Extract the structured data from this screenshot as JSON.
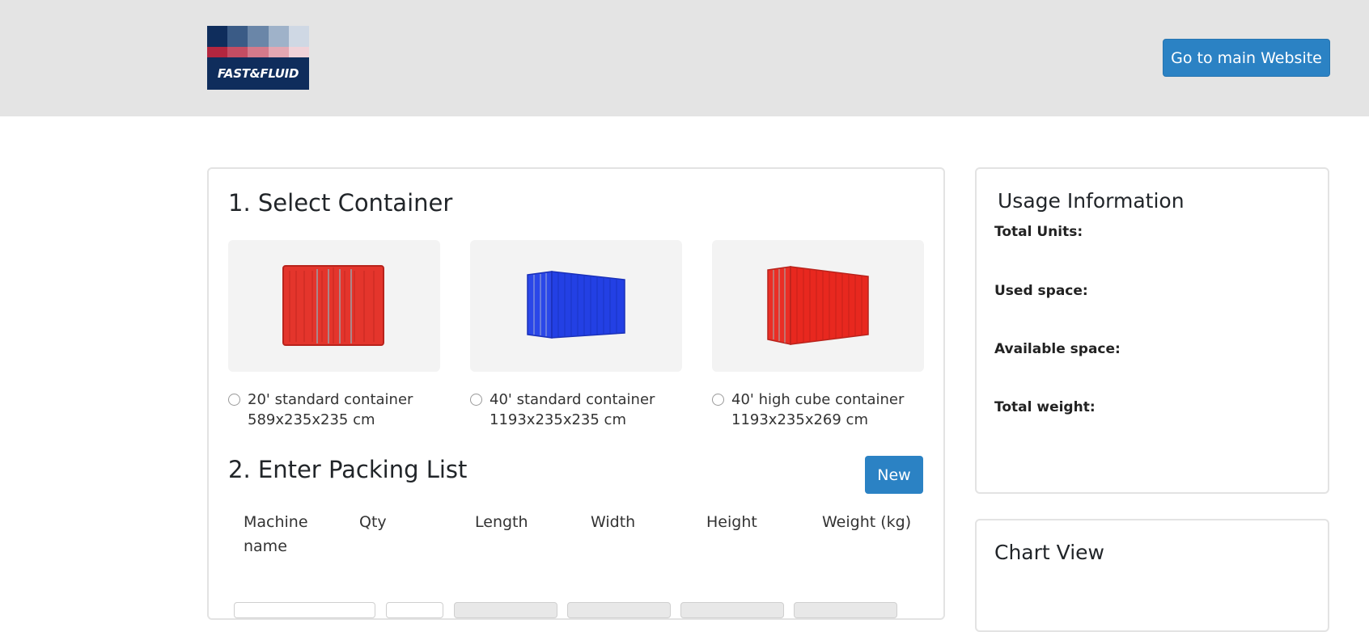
{
  "header": {
    "logo_text": "FAST&FLUID",
    "main_site_label": "Go to main Website"
  },
  "select": {
    "title": "1. Select Container",
    "options": [
      {
        "name": "20' standard container",
        "dims": "589x235x235 cm",
        "color": "#e8302a"
      },
      {
        "name": "40' standard container",
        "dims": "1193x235x235 cm",
        "color": "#1f3fe0"
      },
      {
        "name": "40' high cube container",
        "dims": "1193x235x269 cm",
        "color": "#ea2a22"
      }
    ]
  },
  "packing": {
    "title": "2. Enter Packing List",
    "new_label": "New",
    "columns": [
      "Machine name",
      "Qty",
      "Length",
      "Width",
      "Height",
      "Weight (kg)"
    ]
  },
  "usage": {
    "title": "Usage Information",
    "total_units": "Total Units:",
    "used_space": "Used space:",
    "available_space": "Available space:",
    "total_weight": "Total weight:"
  },
  "chart": {
    "title": "Chart View"
  },
  "colors": {
    "accent": "#2b82c4",
    "header_bg": "#e4e4e4",
    "logo_navy": "#0f2d5c"
  }
}
